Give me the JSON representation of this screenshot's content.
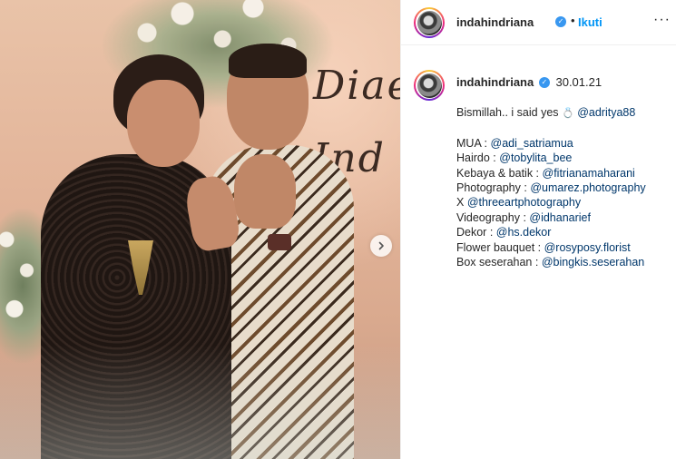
{
  "header": {
    "username": "indahindriana",
    "separator": "•",
    "follow_label": "Ikuti",
    "more_label": "···",
    "verified_icon": "check"
  },
  "photo": {
    "script_text": "Diae Ind",
    "next_icon": "›"
  },
  "caption": {
    "username": "indahindriana",
    "date": "30.01.21",
    "intro_text": "Bismillah.. i said yes ",
    "ring_icon": "💍",
    "intro_mention": "@adritya88",
    "credits": [
      {
        "label": "MUA : ",
        "mention": "@adi_satriamua"
      },
      {
        "label": "Hairdo : ",
        "mention": "@tobylita_bee"
      },
      {
        "label": "Kebaya & batik : ",
        "mention": "@fitrianamaharani"
      },
      {
        "label": "Photography : ",
        "mention": "@umarez.photography"
      },
      {
        "label": "X ",
        "mention": "@threeartphotography"
      },
      {
        "label": "Videography : ",
        "mention": "@idhanarief"
      },
      {
        "label": "Dekor : ",
        "mention": "@hs.dekor"
      },
      {
        "label": "Flower bauquet : ",
        "mention": "@rosyposy.florist"
      },
      {
        "label": "Box seserahan : ",
        "mention": "@bingkis.seserahan"
      }
    ]
  },
  "colors": {
    "link": "#00376b",
    "follow": "#0095f6",
    "verified": "#3897f0",
    "text": "#262626"
  }
}
